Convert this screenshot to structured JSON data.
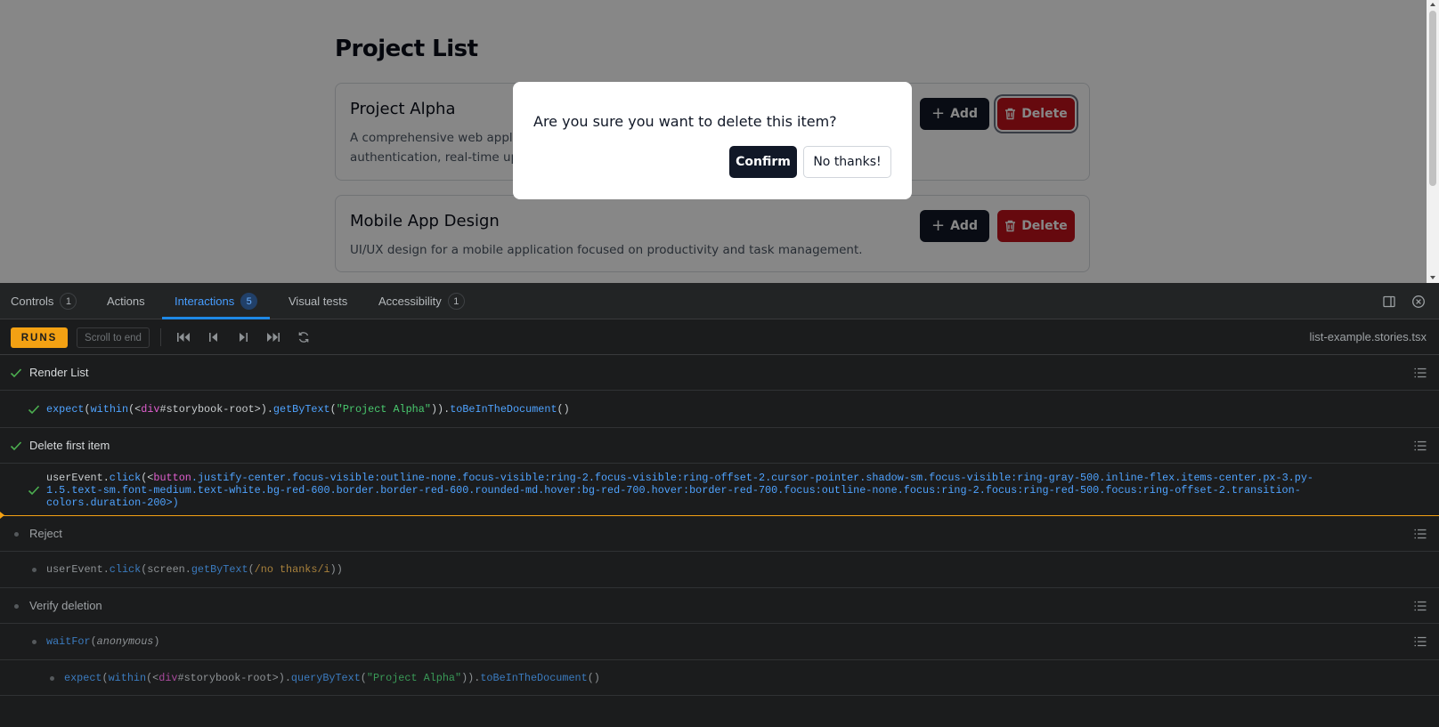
{
  "preview": {
    "page_title": "Project List",
    "projects": [
      {
        "title": "Project Alpha",
        "description": "A comprehensive web application built with React and TypeScript featuring user authentication, real-time updates",
        "description_visible_line1": "A comprehensive web applica",
        "description_visible_line2": "authentication, real-time upda",
        "add_label": "Add",
        "delete_label": "Delete"
      },
      {
        "title": "Mobile App Design",
        "description": "UI/UX design for a mobile application focused on productivity and task management.",
        "add_label": "Add",
        "delete_label": "Delete"
      }
    ],
    "dialog": {
      "message": "Are you sure you want to delete this item?",
      "confirm_label": "Confirm",
      "cancel_label": "No thanks!"
    }
  },
  "panel": {
    "tabs": [
      {
        "label": "Controls",
        "count": "1"
      },
      {
        "label": "Actions",
        "count": ""
      },
      {
        "label": "Interactions",
        "count": "5"
      },
      {
        "label": "Visual tests",
        "count": ""
      },
      {
        "label": "Accessibility",
        "count": "1"
      }
    ],
    "toolbar": {
      "status_badge": "RUNS",
      "scroll_to_end_label": "Scroll to end",
      "filename": "list-example.stories.tsx"
    },
    "steps": [
      {
        "label": "Render List",
        "status": "passed"
      },
      {
        "code_parts": [
          "expect",
          "(",
          "within",
          "(<",
          "div",
          "#storybook-root>).",
          "getByText",
          "(",
          "\"Project Alpha\"",
          ")).",
          "toBeInTheDocument",
          "()"
        ],
        "status": "passed"
      },
      {
        "label": "Delete first item",
        "status": "passed"
      },
      {
        "code_line1_prefix": "userEvent.",
        "code_line1_fn": "click",
        "code_line1_open": "(<",
        "code_line1_el": "button",
        "code_line1_rest": ".justify-center.focus-visible:outline-none.focus-visible:ring-2.focus-visible:ring-offset-2.cursor-pointer.shadow-sm.focus-visible:ring-gray-500.inline-flex.items-center.px-3.py-",
        "code_line2": "1.5.text-sm.font-medium.text-white.bg-red-600.border.border-red-600.rounded-md.hover:bg-red-700.hover:border-red-700.focus:outline-none.focus:ring-2.focus:ring-red-500.focus:ring-offset-2.transition-",
        "code_line3": "colors.duration-200>)",
        "status": "passed"
      },
      {
        "label": "Reject",
        "status": "pending"
      },
      {
        "code_prefix": "userEvent.",
        "code_fn": "click",
        "code_open": "(screen.",
        "code_fn2": "getByText",
        "code_paren": "(",
        "code_rx": "/no thanks/i",
        "code_close": "))",
        "status": "pending"
      },
      {
        "label": "Verify deletion",
        "status": "pending"
      },
      {
        "code_fn": "waitFor",
        "code_open": "(",
        "code_anon": "anonymous",
        "code_close": ")",
        "status": "pending"
      },
      {
        "code_parts": [
          "expect",
          "(",
          "within",
          "(<",
          "div",
          "#storybook-root>).",
          "queryByText",
          "(",
          "\"Project Alpha\"",
          ")).",
          "toBeInTheDocument",
          "()"
        ],
        "status": "pending"
      }
    ]
  },
  "colors": {
    "accent": "#1e88e5",
    "runs_badge": "#f3a113",
    "delete_red": "#c0121b",
    "pass_green": "#4caf50"
  }
}
